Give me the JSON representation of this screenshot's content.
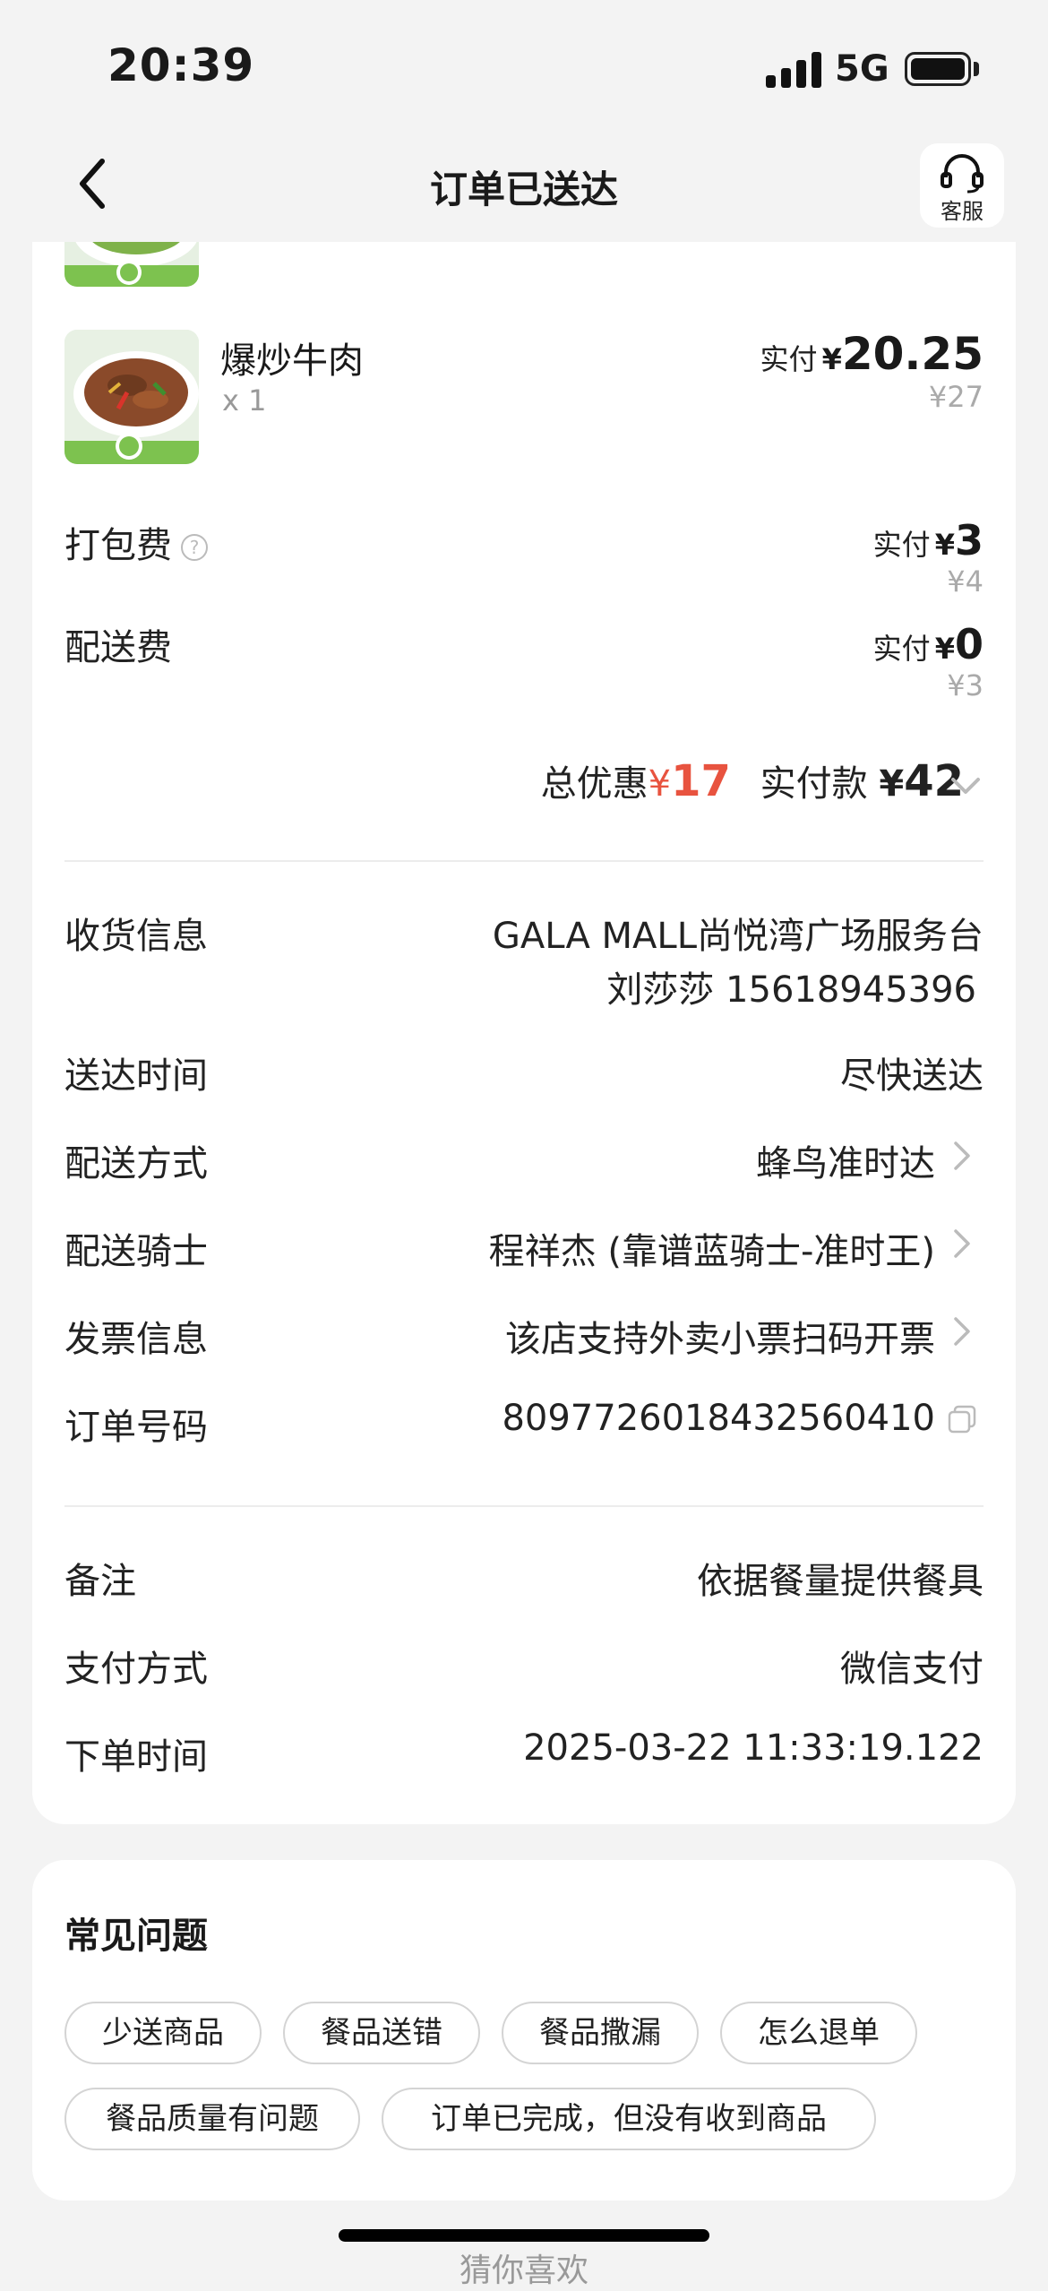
{
  "status_bar": {
    "time": "20:39",
    "network": "5G"
  },
  "nav": {
    "title": "订单已送达",
    "service_label": "客服"
  },
  "item": {
    "name": "爆炒牛肉",
    "qty": "x 1",
    "paid_label": "实付",
    "currency": "¥",
    "paid_amount": "20.25",
    "original": "¥27"
  },
  "fees": {
    "packing": {
      "label": "打包费",
      "help": "?",
      "paid_label": "实付",
      "currency": "¥",
      "paid": "3",
      "original": "¥4"
    },
    "delivery": {
      "label": "配送费",
      "paid_label": "实付",
      "currency": "¥",
      "paid": "0",
      "original": "¥3"
    }
  },
  "summary": {
    "discount_label": "总优惠",
    "discount_currency": "¥",
    "discount_amount": "17",
    "total_label": "实付款",
    "total_currency": "¥",
    "total_amount": "42"
  },
  "info": {
    "address": {
      "label": "收货信息",
      "line1": "GALA MALL尚悦湾广场服务台",
      "line2": "刘莎莎 15618945396"
    },
    "time": {
      "label": "送达时间",
      "value": "尽快送达"
    },
    "method": {
      "label": "配送方式",
      "value": "蜂鸟准时达"
    },
    "rider": {
      "label": "配送骑士",
      "value": "程祥杰 (靠谱蓝骑士-准时王)"
    },
    "invoice": {
      "label": "发票信息",
      "value": "该店支持外卖小票扫码开票"
    },
    "order_no": {
      "label": "订单号码",
      "value": "8097726018432560410"
    }
  },
  "extra": {
    "note": {
      "label": "备注",
      "value": "依据餐量提供餐具"
    },
    "payment": {
      "label": "支付方式",
      "value": "微信支付"
    },
    "order_time": {
      "label": "下单时间",
      "value": "2025-03-22 11:33:19.122"
    }
  },
  "faq": {
    "title": "常见问题",
    "chips": [
      "少送商品",
      "餐品送错",
      "餐品撒漏",
      "怎么退单",
      "餐品质量有问题",
      "订单已完成，但没有收到商品"
    ]
  },
  "bottom_peek": "猜你喜欢"
}
